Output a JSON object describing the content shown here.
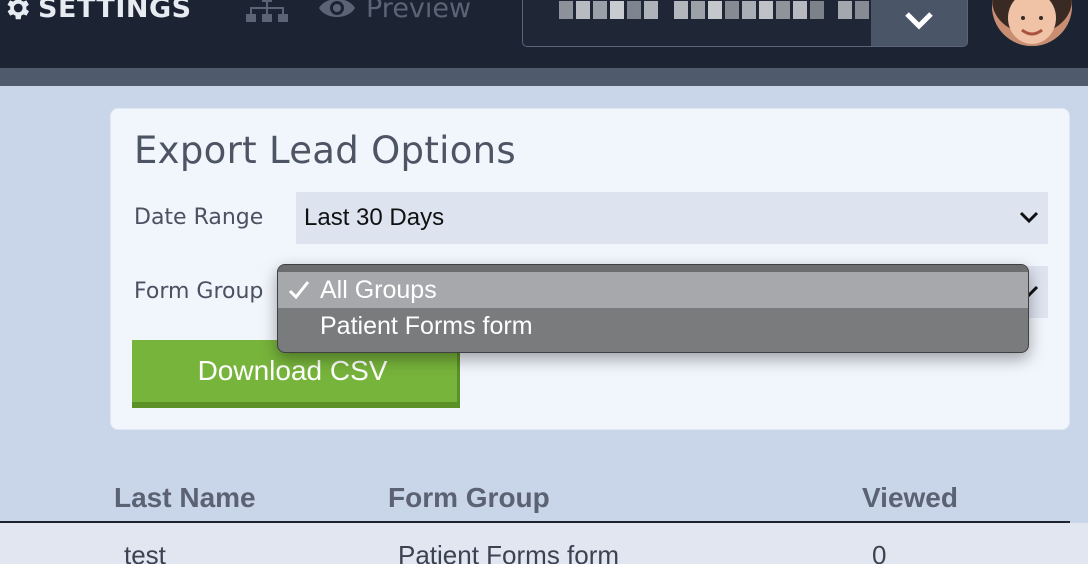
{
  "nav": {
    "settings_label": "SETTINGS",
    "preview_label": "Preview",
    "account_value": ""
  },
  "export_card": {
    "title": "Export Lead Options",
    "date_range": {
      "label": "Date Range",
      "selected": "Last 30 Days"
    },
    "form_group": {
      "label": "Form Group",
      "selected": "All Groups",
      "options": [
        "All Groups",
        "Patient Forms form"
      ]
    },
    "download_label": "Download CSV"
  },
  "table": {
    "columns": [
      "Last Name",
      "Form Group",
      "Viewed"
    ],
    "rows": [
      [
        "test",
        "Patient Forms form",
        "0"
      ]
    ]
  },
  "colors": {
    "topbar": "#1c2333",
    "page_bg": "#c9d5e8",
    "download_green": "#77b43b",
    "dropdown_gray": "#7a7b7d"
  }
}
